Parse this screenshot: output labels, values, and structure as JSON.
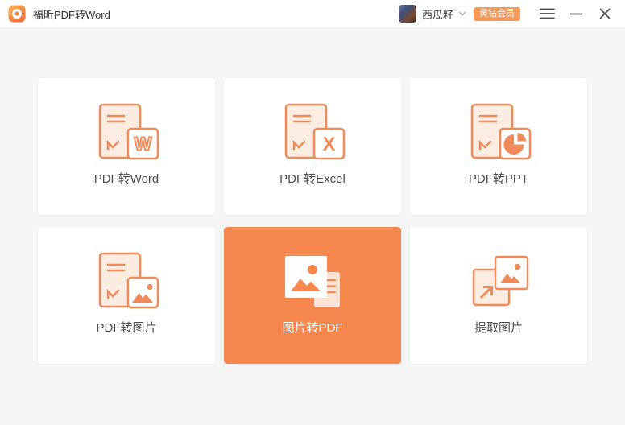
{
  "titlebar": {
    "app_title": "福昕PDF转Word",
    "user": {
      "name": "西瓜籽",
      "membership_badge": "黄钻会员"
    }
  },
  "colors": {
    "accent_orange": "#F6874E",
    "badge_orange": "#F8995A",
    "icon_stroke": "#F08A58",
    "icon_fill_peach": "#FCEDE3",
    "window_background": "#F5F5F6",
    "titlebar_background": "#FFFFFF",
    "card_background": "#FFFFFF",
    "label_text": "#4D4D4D",
    "title_text": "#333333"
  },
  "icons": {
    "app_logo": "foxit-logo",
    "user_chevron": "chevron-down",
    "menu": "hamburger-menu",
    "minimize": "minimize-line",
    "close": "close-x"
  },
  "cards": [
    {
      "label": "PDF转Word",
      "icon": "pdf-to-word-icon",
      "active": false
    },
    {
      "label": "PDF转Excel",
      "icon": "pdf-to-excel-icon",
      "active": false
    },
    {
      "label": "PDF转PPT",
      "icon": "pdf-to-ppt-icon",
      "active": false
    },
    {
      "label": "PDF转图片",
      "icon": "pdf-to-image-icon",
      "active": false
    },
    {
      "label": "图片转PDF",
      "icon": "image-to-pdf-icon",
      "active": true
    },
    {
      "label": "提取图片",
      "icon": "extract-image-icon",
      "active": false
    }
  ]
}
